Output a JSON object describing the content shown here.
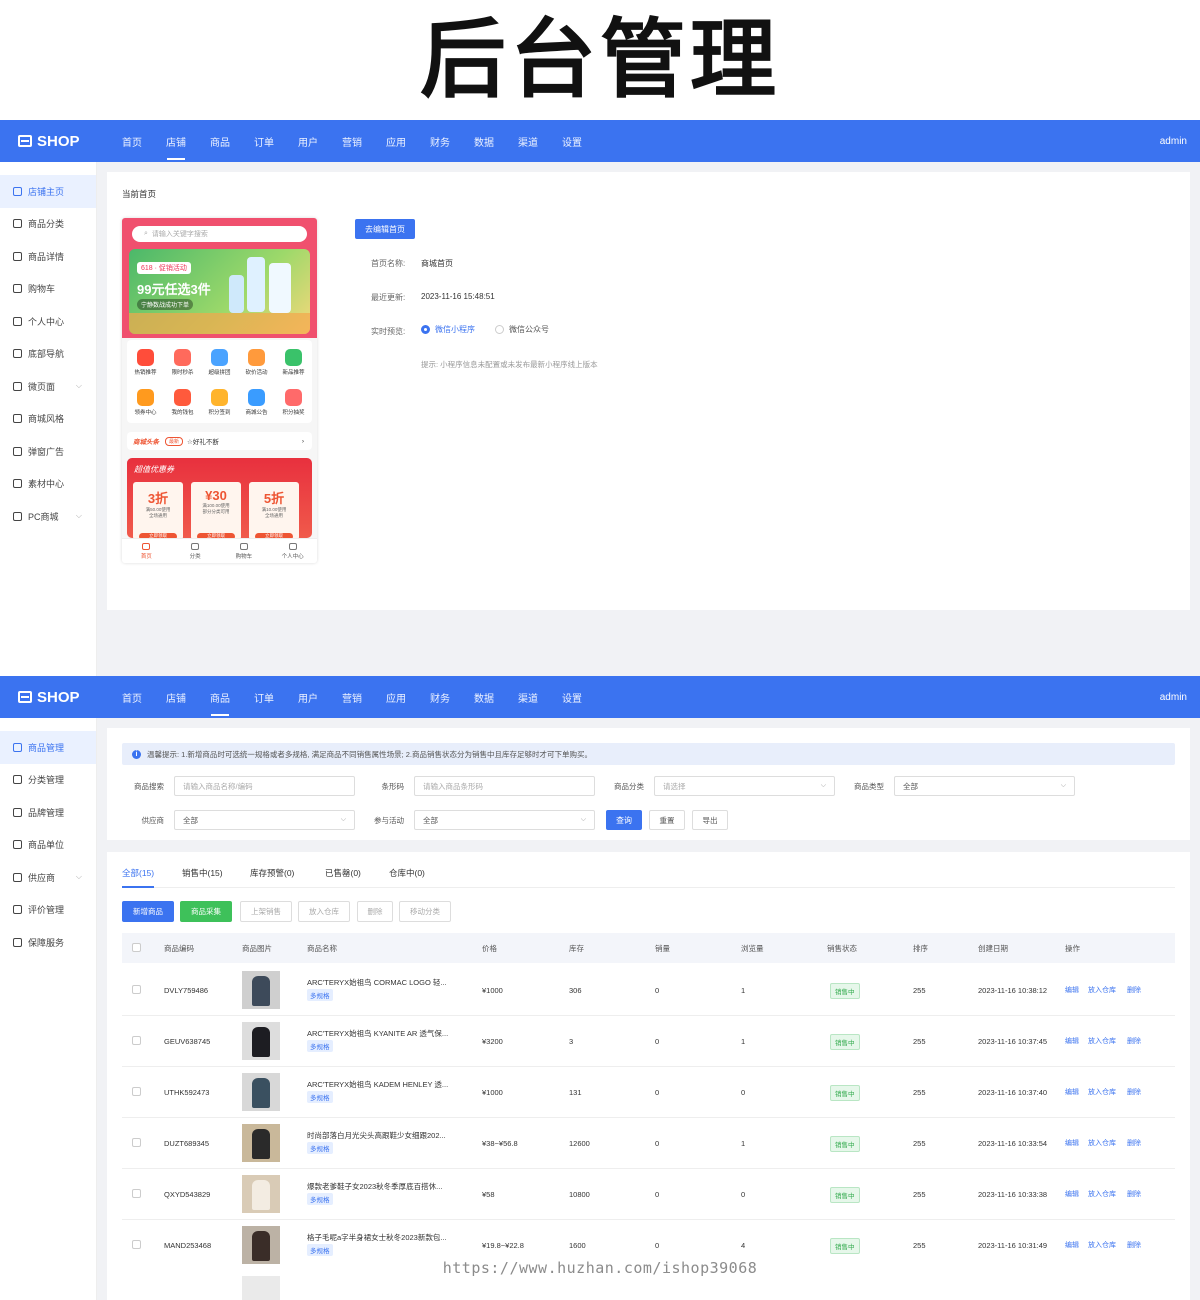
{
  "banner_title": "后台管理",
  "app": {
    "logo": "SHOP",
    "user": "admin"
  },
  "nav": [
    "首页",
    "店铺",
    "商品",
    "订单",
    "用户",
    "营销",
    "应用",
    "财务",
    "数据",
    "渠道",
    "设置"
  ],
  "shop": {
    "sidebar": [
      {
        "label": "店铺主页",
        "icon": "home-icon"
      },
      {
        "label": "商品分类",
        "icon": "category-icon"
      },
      {
        "label": "商品详情",
        "icon": "detail-icon"
      },
      {
        "label": "购物车",
        "icon": "cart-icon"
      },
      {
        "label": "个人中心",
        "icon": "user-icon"
      },
      {
        "label": "底部导航",
        "icon": "nav-icon"
      },
      {
        "label": "微页面",
        "icon": "page-icon",
        "caret": "⌵"
      },
      {
        "label": "商城风格",
        "icon": "style-icon"
      },
      {
        "label": "弹窗广告",
        "icon": "popup-icon"
      },
      {
        "label": "素材中心",
        "icon": "media-icon"
      },
      {
        "label": "PC商城",
        "icon": "pc-icon",
        "caret": "⌵"
      }
    ],
    "panel_title": "当前首页",
    "edit_button": "去编辑首页",
    "fields": {
      "name_label": "首页名称:",
      "name_value": "商城首页",
      "updated_label": "最近更新:",
      "updated_value": "2023-11-16 15:48:51",
      "preview_label": "实时预览:",
      "preview_opt1": "微信小程序",
      "preview_opt2": "微信公众号",
      "hint": "提示: 小程序信息未配置或未发布最新小程序线上版本"
    },
    "phone": {
      "search_placeholder": "请输入关键字搜索",
      "promo_tag": "618 · 促销活动",
      "promo_title": "99元任选3件",
      "promo_sub": "宁静数战成功下单",
      "grid": [
        "热销推荐",
        "限时秒杀",
        "超级拼团",
        "砍价活动",
        "新品推荐",
        "领券中心",
        "我的钱包",
        "积分签到",
        "商城公告",
        "积分抽奖"
      ],
      "news_label": "商城头条",
      "news_badge": "最新",
      "news_text": "☆好礼不断",
      "news_arrow": "›",
      "coupon_title": "超值优惠券",
      "coupons": [
        {
          "value": "3折",
          "desc": "满50.00使用",
          "scope": "全场通用",
          "btn": "立即领取"
        },
        {
          "value": "¥30",
          "desc": "满100.00使用",
          "scope": "部分分类可用",
          "btn": "立即领取"
        },
        {
          "value": "5折",
          "desc": "满10.00使用",
          "scope": "全场通用",
          "btn": "立即领取"
        }
      ],
      "tabbar": [
        "首页",
        "分类",
        "购物车",
        "个人中心"
      ]
    }
  },
  "goods": {
    "sidebar": [
      {
        "label": "商品管理",
        "icon": "goods-icon"
      },
      {
        "label": "分类管理",
        "icon": "category-icon"
      },
      {
        "label": "品牌管理",
        "icon": "brand-icon"
      },
      {
        "label": "商品单位",
        "icon": "unit-icon"
      },
      {
        "label": "供应商",
        "icon": "supplier-icon",
        "caret": "⌵"
      },
      {
        "label": "评价管理",
        "icon": "review-icon"
      },
      {
        "label": "保障服务",
        "icon": "service-icon"
      }
    ],
    "tip": "温馨提示: 1.新增商品时可选统一规格或者多规格, 满足商品不同销售属性场景; 2.商品销售状态分为销售中且库存足够时才可下单购买。",
    "filters": {
      "search_label": "商品搜索",
      "search_ph": "请输入商品名称/编码",
      "barcode_label": "条形码",
      "barcode_ph": "请输入商品条形码",
      "cat_label": "商品分类",
      "cat_ph": "请选择",
      "type_label": "商品类型",
      "type_val": "全部",
      "supplier_label": "供应商",
      "supplier_val": "全部",
      "activity_label": "参与活动",
      "activity_val": "全部",
      "query": "查询",
      "reset": "重置",
      "export": "导出"
    },
    "tabs": [
      "全部(15)",
      "销售中(15)",
      "库存预警(0)",
      "已售罄(0)",
      "仓库中(0)"
    ],
    "actions": [
      "新增商品",
      "商品采集",
      "上架销售",
      "放入仓库",
      "删除",
      "移动分类"
    ],
    "columns": [
      "商品编码",
      "商品图片",
      "商品名称",
      "价格",
      "库存",
      "销量",
      "浏览量",
      "销售状态",
      "排序",
      "创建日期",
      "操作"
    ],
    "multi_label": "多规格",
    "ops": [
      "编辑",
      "放入仓库",
      "删除"
    ],
    "rows": [
      {
        "code": "DVLY759486",
        "name": "ARC'TERYX始祖鸟 CORMAC LOGO 轻...",
        "price": "¥1000",
        "stock": "306",
        "sales": "0",
        "views": "1",
        "status": "销售中",
        "sort": "255",
        "date": "2023-11-16 10:38:12"
      },
      {
        "code": "GEUV638745",
        "name": "ARC'TERYX始祖鸟 KYANITE AR 透气保...",
        "price": "¥3200",
        "stock": "3",
        "sales": "0",
        "views": "1",
        "status": "销售中",
        "sort": "255",
        "date": "2023-11-16 10:37:45"
      },
      {
        "code": "UTHK592473",
        "name": "ARC'TERYX始祖鸟 KADEM HENLEY 透...",
        "price": "¥1000",
        "stock": "131",
        "sales": "0",
        "views": "0",
        "status": "销售中",
        "sort": "255",
        "date": "2023-11-16 10:37:40"
      },
      {
        "code": "DUZT689345",
        "name": "时尚部落白月光尖头高跟鞋少女细跟202...",
        "price": "¥38~¥56.8",
        "stock": "12600",
        "sales": "0",
        "views": "1",
        "status": "销售中",
        "sort": "255",
        "date": "2023-11-16 10:33:54"
      },
      {
        "code": "QXYD543829",
        "name": "爆款老爹鞋子女2023秋冬季厚底百搭休...",
        "price": "¥58",
        "stock": "10800",
        "sales": "0",
        "views": "0",
        "status": "销售中",
        "sort": "255",
        "date": "2023-11-16 10:33:38"
      },
      {
        "code": "MAND253468",
        "name": "格子毛呢a字半身裙女士秋冬2023新款包...",
        "price": "¥19.8~¥22.8",
        "stock": "1600",
        "sales": "0",
        "views": "4",
        "status": "销售中",
        "sort": "255",
        "date": "2023-11-16 10:31:49"
      }
    ]
  },
  "watermark": "https://www.huzhan.com/ishop39068"
}
